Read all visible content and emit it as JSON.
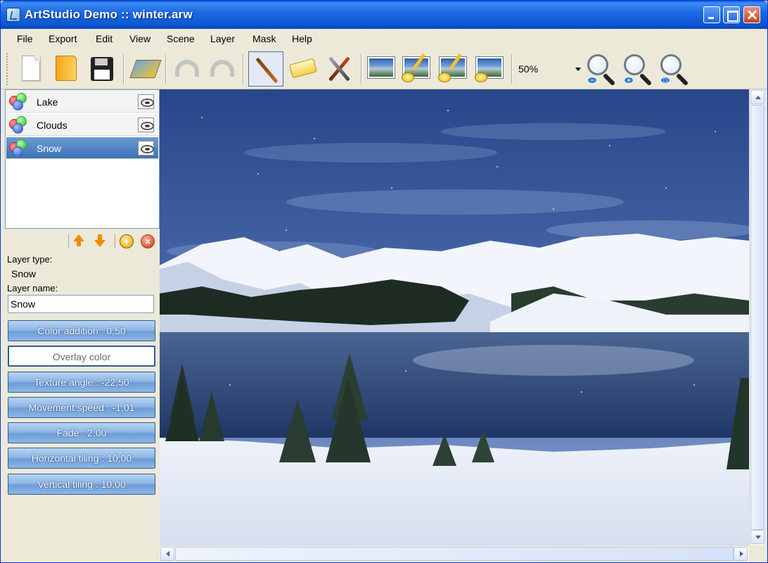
{
  "window": {
    "title": "ArtStudio Demo :: winter.arw"
  },
  "menu": [
    "File",
    "Export",
    "Edit",
    "View",
    "Scene",
    "Layer",
    "Mask",
    "Help"
  ],
  "toolbar": {
    "zoom_value": "50%"
  },
  "layers": [
    {
      "name": "Lake",
      "selected": false
    },
    {
      "name": "Clouds",
      "selected": false
    },
    {
      "name": "Snow",
      "selected": true
    }
  ],
  "properties": {
    "layer_type_label": "Layer type:",
    "layer_type_value": "Snow",
    "layer_name_label": "Layer name:",
    "layer_name_value": "Snow",
    "buttons": [
      "Color addition : 0,50",
      "Overlay color",
      "Texture angle : -22,50",
      "Movement speed : -1,01",
      "Fade : 2,00",
      "Horizontal tiling : 10,00",
      "Vertical tiling : 10,00"
    ]
  },
  "icons": {
    "app": "artstudio-app-icon",
    "new": "new-document-icon",
    "open": "open-folder-icon",
    "save": "save-floppy-icon",
    "layers": "layers-icon",
    "undo": "undo-icon",
    "redo": "redo-icon",
    "brush": "brush-icon",
    "eraser": "eraser-icon",
    "tools": "tools-icon",
    "zoom_out": "zoom-out-icon",
    "zoom_in": "zoom-in-icon",
    "zoom_fit": "zoom-fit-icon"
  },
  "colors": {
    "titlebar": "#1d6ae4",
    "selected_layer": "#3c73b7",
    "property_button": "#8db7e6"
  }
}
